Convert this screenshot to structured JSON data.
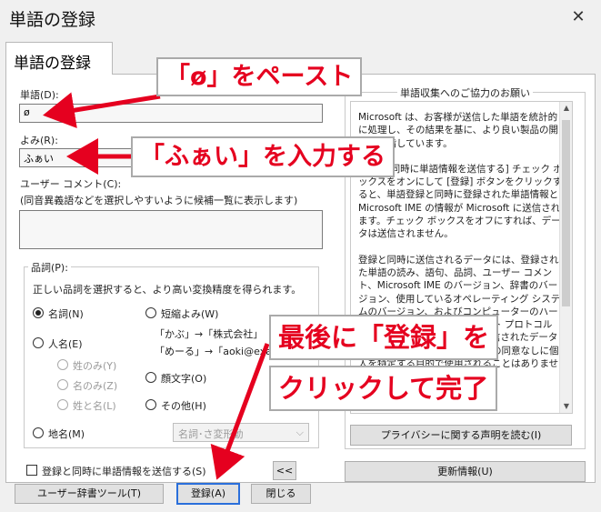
{
  "window": {
    "title": "単語の登録",
    "close_glyph": "✕"
  },
  "tab": {
    "label": "単語の登録"
  },
  "fields": {
    "word_label": "単語(D):",
    "word_value": "ø",
    "reading_label": "よみ(R):",
    "reading_value": "ふぁい",
    "comment_label": "ユーザー コメント(C):",
    "comment_hint": "(同音異義語などを選択しやすいように候補一覧に表示します)",
    "comment_value": ""
  },
  "pos_group": {
    "title": "品詞(P):",
    "hint": "正しい品詞を選択すると、より高い変換精度を得られます。",
    "options": {
      "noun": "名詞(N)",
      "short_reading": "短縮よみ(W)",
      "person": "人名(E)",
      "surname_only": "姓のみ(Y)",
      "given_only": "名のみ(Z)",
      "full_name": "姓と名(L)",
      "emoticon": "顔文字(O)",
      "other": "その他(H)",
      "place": "地名(M)"
    },
    "examples": {
      "line1": "「かぶ」→「株式会社」",
      "line2": "「めーる」→「aoki@example"
    },
    "dropdown_value": "名詞･さ変形動",
    "selected": "noun"
  },
  "info_group": {
    "title": "単語収集へのご協力のお願い",
    "text_p1": "Microsoft は、お客様が送信した単語を統計的に処理し、その結果を基に、より良い製品の開発を目指しています。",
    "text_p2": "[登録と同時に単語情報を送信する] チェック ボックスをオンにして [登録] ボタンをクリックすると、単語登録と同時に登録された単語情報と Microsoft IME の情報が Microsoft に送信されます。チェック ボックスをオフにすれば、データは送信されません。",
    "text_p3": "登録と同時に送信されるデータには、登録された単語の読み、語句、品詞、ユーザー コメント、Microsoft IME のバージョン、辞書のバージョン、使用しているオペレーティング システムのバージョン、およびコンピューターのハードウェアの種類、インターネット プロトコル (IP) アドレスが含まれます。送信されたデータに含まれる個人情報は、お客様の同意なしに個人を特定する目的で使用されることはありません。",
    "privacy_button": "プライバシーに関する声明を読む(I)",
    "update_button": "更新情報(U)"
  },
  "bottom": {
    "send_checkbox_label": "登録と同時に単語情報を送信する(S)",
    "send_checked": false,
    "collapse_button": "<<",
    "dict_tool_button": "ユーザー辞書ツール(T)",
    "register_button": "登録(A)",
    "close_button": "閉じる"
  },
  "annotations": {
    "paste": "「ø」をペースト",
    "type": "「ふぁい」を入力する",
    "finish_line1": "最後に「登録」を",
    "finish_line2": "クリックして完了"
  },
  "colors": {
    "annotation": "#e5001f",
    "accent": "#2a6fdb"
  }
}
